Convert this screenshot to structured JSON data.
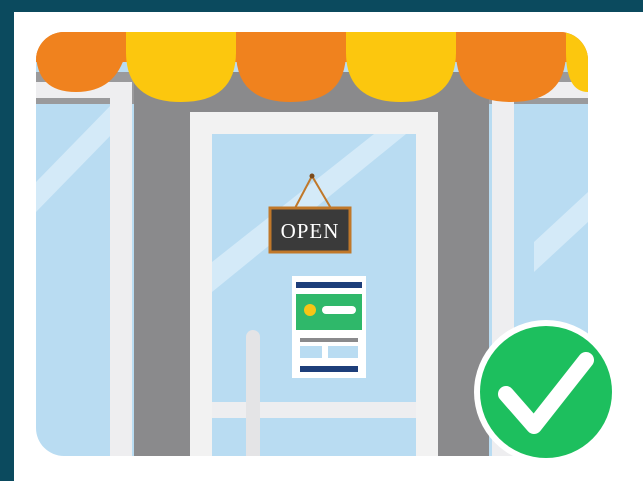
{
  "illustration": {
    "sign_text": "OPEN",
    "check_badge_icon": "checkmark-icon",
    "colors": {
      "background": "#0b4a5e",
      "awning_orange": "#f0821e",
      "awning_yellow": "#fcc70e",
      "glass": "#b9dcf2",
      "wall_gray": "#8a8a8c",
      "frame_white": "#f2f2f2",
      "sign_board": "#3a3a3a",
      "sign_border": "#c0782a",
      "badge_green": "#1dbf5e"
    }
  }
}
